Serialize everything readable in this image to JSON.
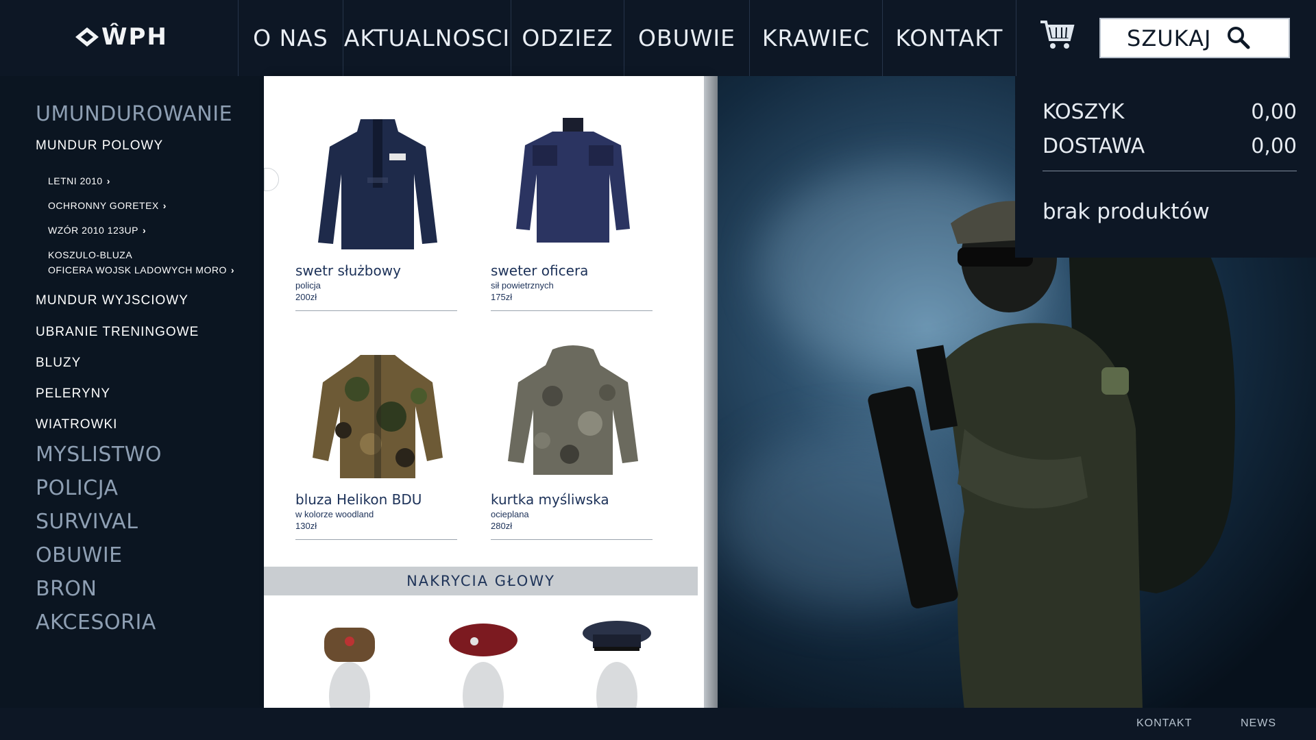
{
  "brand": {
    "logo_text": "ŴPH"
  },
  "nav": {
    "items": [
      "O NAS",
      "AKTUALNOSCI",
      "ODZIEZ",
      "OBUWIE",
      "KRAWIEC",
      "KONTAKT"
    ],
    "cart_icon": "cart-icon",
    "search_label": "SZUKAJ",
    "search_icon": "search-icon"
  },
  "sidebar": {
    "category_main": "UMUNDUROWANIE",
    "sub_active": "MUNDUR POLOWY",
    "subsub": [
      "LETNI 2010",
      "OCHRONNY GORETEX",
      "WZÓR 2010 123UP"
    ],
    "subsub_multi": [
      "KOSZULO-BLUZA",
      "OFICERA WOJSK LADOWYCH MORO"
    ],
    "subs": [
      "MUNDUR WYJSCIOWY",
      "UBRANIE TRENINGOWE",
      "BLUZY",
      "PELERYNY",
      "WIATROWKI"
    ],
    "categories": [
      "MYSLISTWO",
      "POLICJA",
      "SURVIVAL",
      "OBUWIE",
      "BRON",
      "AKCESORIA"
    ]
  },
  "products": [
    {
      "name": "swetr służbowy",
      "sub": "policja",
      "price": "200zł"
    },
    {
      "name": "sweter oficera",
      "sub": "sił powietrznych",
      "price": "175zł"
    },
    {
      "name": "bluza Helikon BDU",
      "sub": "w kolorze woodland",
      "price": "130zł"
    },
    {
      "name": "kurtka myśliwska",
      "sub": "ocieplana",
      "price": "280zł"
    }
  ],
  "section": {
    "title": "NAKRYCIA GŁOWY"
  },
  "cart": {
    "koszyk_label": "KOSZYK",
    "koszyk_value": "0,00",
    "dostawa_label": "DOSTAWA",
    "dostawa_value": "0,00",
    "empty": "brak produktów"
  },
  "footer": {
    "links": [
      "KONTAKT",
      "NEWS"
    ]
  },
  "colors": {
    "background": "#0b1521",
    "accent": "#1c3158",
    "sidebar_text": "#8e9fb3"
  }
}
